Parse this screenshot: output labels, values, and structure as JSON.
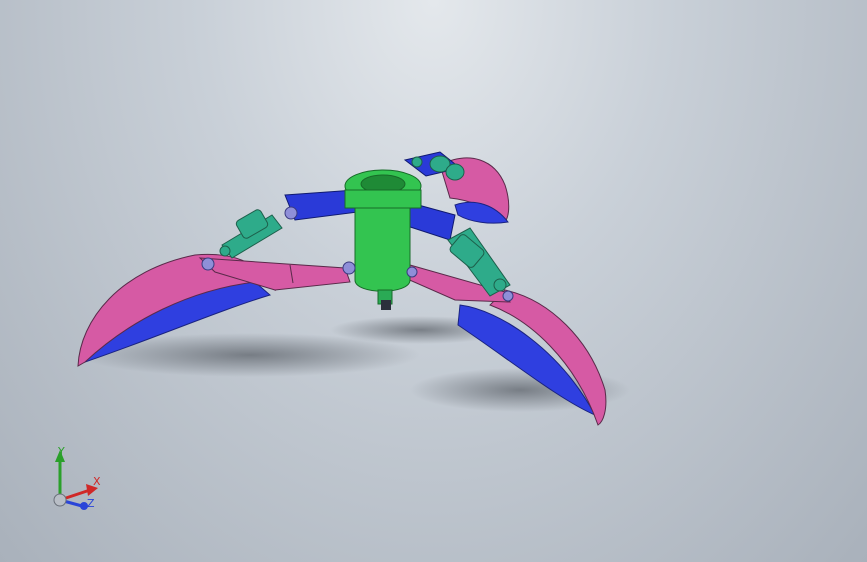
{
  "viewport": {
    "background": "gradient-gray",
    "model": "three-jaw-orange-peel-grab"
  },
  "colors": {
    "jaw_outer": "#d65aa4",
    "jaw_inner": "#2f3fe0",
    "link": "#2a3ad8",
    "hub": "#33c450",
    "cylinder": "#2eab8a",
    "pin": "#8f8fd8"
  },
  "triad": {
    "y_label": "Y",
    "x_label": "X",
    "z_label": "Z"
  }
}
